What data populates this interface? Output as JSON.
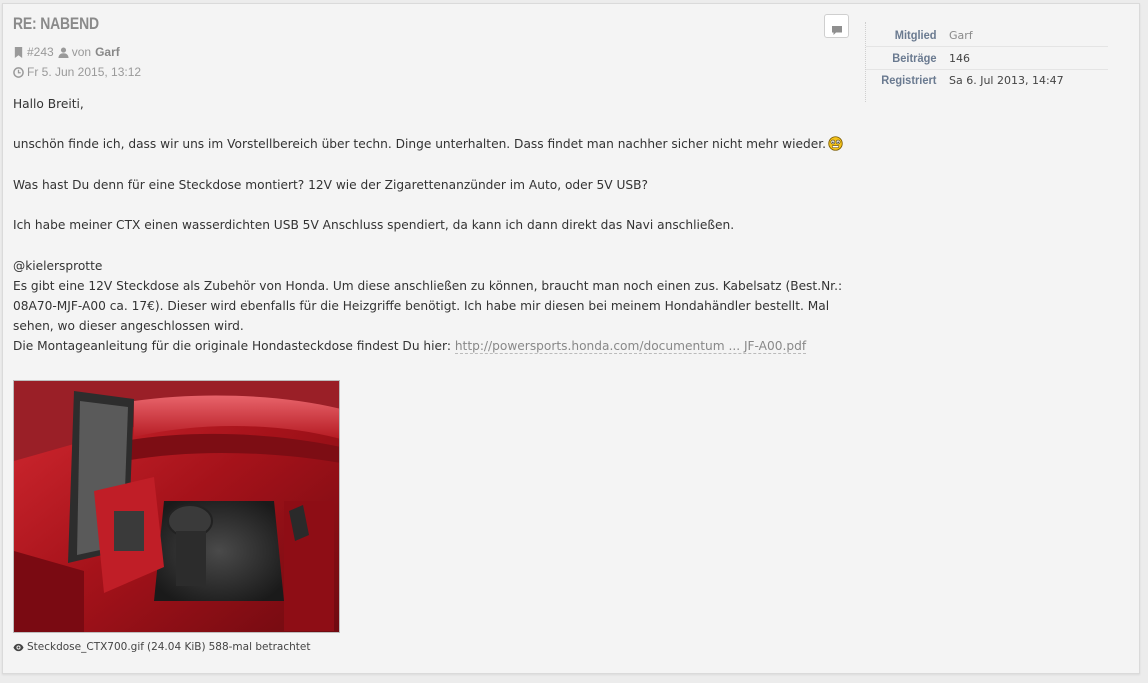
{
  "post": {
    "title": "Re: Nabend",
    "number": "#243",
    "by_prefix": "von",
    "author": "Garf",
    "date": "Fr 5. Jun 2015, 13:12",
    "icons": [
      "bookmark-icon",
      "user-icon",
      "clock-icon",
      "quote-icon"
    ],
    "paragraphs": {
      "p1": "Hallo Breiti,",
      "p2": "unschön finde ich, dass wir uns im Vorstellbereich über techn. Dinge unterhalten. Dass findet man nachher sicher nicht mehr wieder.",
      "p3": "Was hast Du denn für eine Steckdose montiert? 12V wie der Zigarettenanzünder im Auto, oder 5V USB?",
      "p4": "Ich habe meiner CTX einen wasserdichten USB 5V Anschluss spendiert, da kann ich dann direkt das Navi anschließen.",
      "p5_mention": "@kielersprotte",
      "p5_line1": "Es gibt eine 12V Steckdose als Zubehör von Honda. Um diese anschließen zu können, braucht man noch einen zus. Kabelsatz (Best.Nr.: 08A70-MJF-A00 ca. 17€). Dieser wird ebenfalls für die Heizgriffe benötigt. Ich habe mir diesen bei meinem Hondahändler bestellt. Mal sehen, wo dieser angeschlossen wird.",
      "p5_line2_prefix": "Die Montageanleitung für die originale Hondasteckdose findest Du hier:",
      "p5_link": "http://powersports.honda.com/documentum ... JF-A00.pdf"
    },
    "attachment": {
      "filename": "Steckdose_CTX700.gif",
      "size": "(24.04 KiB)",
      "views": "588-mal betrachtet",
      "icon": "eye-icon"
    }
  },
  "sidebar": {
    "rows": [
      {
        "label": "Mitglied",
        "value": "Garf"
      },
      {
        "label": "Beiträge",
        "value": "146"
      },
      {
        "label": "Registriert",
        "value": "Sa 6. Jul 2013, 14:47"
      }
    ]
  },
  "colors": {
    "background": "#ececec",
    "panel": "#f4f4f4",
    "title": "#8a8a8a",
    "sidebar_label": "#6a7a90",
    "body_text": "#333333",
    "link": "#888888"
  }
}
